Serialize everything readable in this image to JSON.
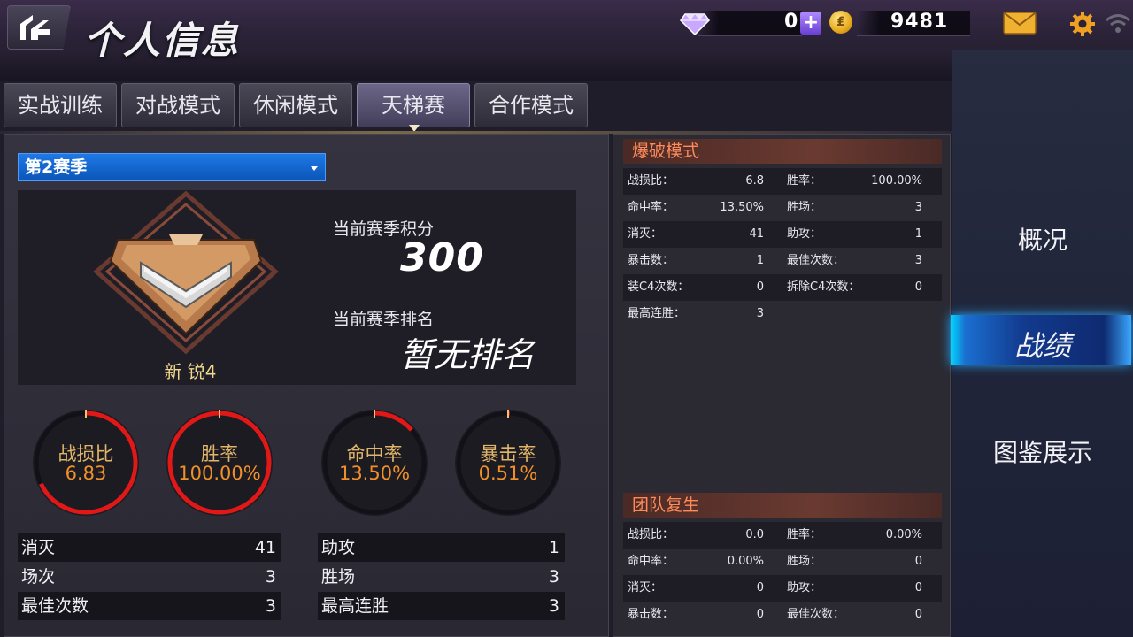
{
  "header": {
    "title": "个人信息",
    "gems": "0",
    "plus": "+",
    "coin_symbol": "₤",
    "coins": "9481"
  },
  "tabs": [
    {
      "label": "实战训练",
      "active": false
    },
    {
      "label": "对战模式",
      "active": false
    },
    {
      "label": "休闲模式",
      "active": false
    },
    {
      "label": "天梯赛",
      "active": true
    },
    {
      "label": "合作模式",
      "active": false
    }
  ],
  "season": {
    "selected": "第2赛季"
  },
  "rank": {
    "name": "新 锐4",
    "score_label": "当前赛季积分",
    "score": "300",
    "rank_label": "当前赛季排名",
    "rank_value": "暂无排名"
  },
  "gauges": [
    {
      "label": "战损比",
      "value": "6.83",
      "fraction": 0.68
    },
    {
      "label": "胜率",
      "value": "100.00%",
      "fraction": 1.0
    },
    {
      "label": "命中率",
      "value": "13.50%",
      "fraction": 0.135
    },
    {
      "label": "暴击率",
      "value": "0.51%",
      "fraction": 0.0051
    }
  ],
  "summary_left": [
    {
      "label": "消灭",
      "value": "41"
    },
    {
      "label": "场次",
      "value": "3"
    },
    {
      "label": "最佳次数",
      "value": "3"
    }
  ],
  "summary_right": [
    {
      "label": "助攻",
      "value": "1"
    },
    {
      "label": "胜场",
      "value": "3"
    },
    {
      "label": "最高连胜",
      "value": "3"
    }
  ],
  "demolition": {
    "title": "爆破模式",
    "rows": [
      {
        "l1": "战损比：",
        "v1": "6.8",
        "l2": "胜率：",
        "v2": "100.00%"
      },
      {
        "l1": "命中率：",
        "v1": "13.50%",
        "l2": "胜场：",
        "v2": "3"
      },
      {
        "l1": "消灭：",
        "v1": "41",
        "l2": "助攻：",
        "v2": "1"
      },
      {
        "l1": "暴击数：",
        "v1": "1",
        "l2": "最佳次数：",
        "v2": "3"
      },
      {
        "l1": "装C4次数：",
        "v1": "0",
        "l2": "拆除C4次数：",
        "v2": "0"
      },
      {
        "l1": "最高连胜：",
        "v1": "3",
        "l2": "",
        "v2": ""
      }
    ]
  },
  "team_respawn": {
    "title": "团队复生",
    "rows": [
      {
        "l1": "战损比：",
        "v1": "0.0",
        "l2": "胜率：",
        "v2": "0.00%"
      },
      {
        "l1": "命中率：",
        "v1": "0.00%",
        "l2": "胜场：",
        "v2": "0"
      },
      {
        "l1": "消灭：",
        "v1": "0",
        "l2": "助攻：",
        "v2": "0"
      },
      {
        "l1": "暴击数：",
        "v1": "0",
        "l2": "最佳次数：",
        "v2": "0"
      }
    ]
  },
  "right_nav": [
    {
      "label": "概况",
      "active": false
    },
    {
      "label": "战绩",
      "active": true
    },
    {
      "label": "图鉴展示",
      "active": false
    }
  ],
  "colors": {
    "accent_orange": "#f0902a",
    "gauge_red": "#e01818",
    "select_blue": "#1f79e6",
    "nav_active": "#1a6fd0"
  }
}
